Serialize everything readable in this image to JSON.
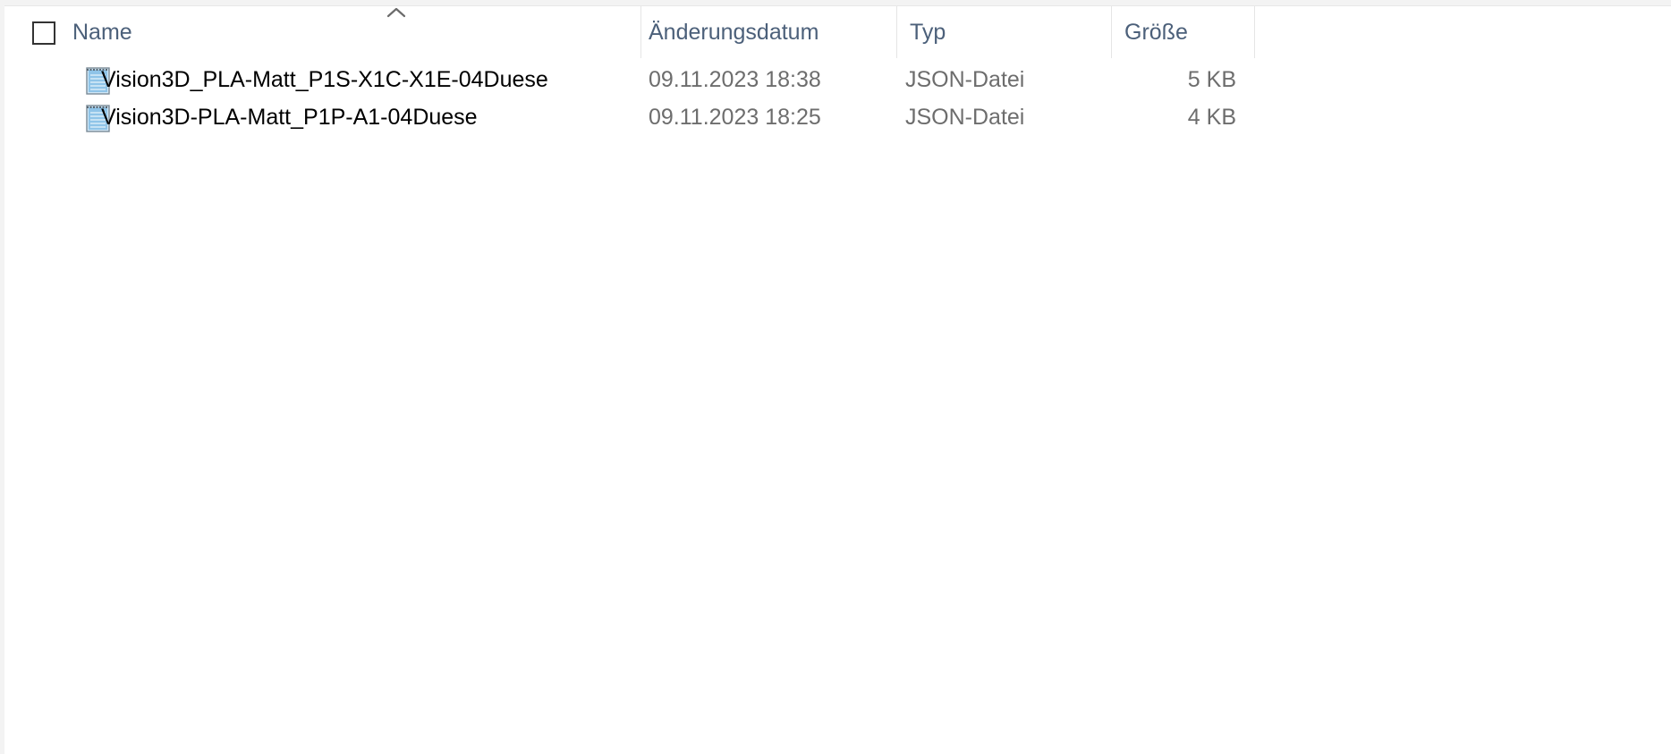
{
  "columns": {
    "name": "Name",
    "date": "Änderungsdatum",
    "type": "Typ",
    "size": "Größe"
  },
  "icons": {
    "sort": "sort-ascending-icon",
    "file": "text-document-icon"
  },
  "files": [
    {
      "name": "Vision3D_PLA-Matt_P1S-X1C-X1E-04Duese",
      "date": "09.11.2023 18:38",
      "type": "JSON-Datei",
      "size": "5 KB"
    },
    {
      "name": "Vision3D-PLA-Matt_P1P-A1-04Duese",
      "date": "09.11.2023 18:25",
      "type": "JSON-Datei",
      "size": "4 KB"
    }
  ],
  "colors": {
    "header_text": "#4c607a",
    "meta_text": "#6d6d6d",
    "icon_fill": "#8fc4e8"
  }
}
